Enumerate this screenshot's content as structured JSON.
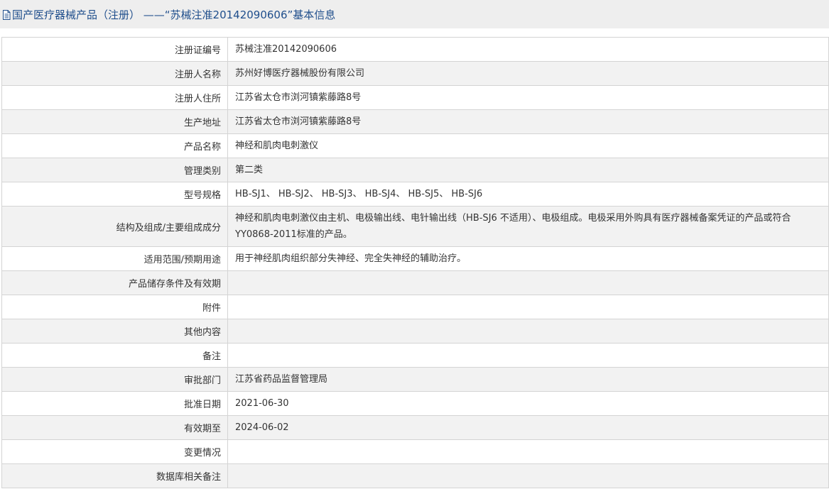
{
  "header": {
    "title": "国产医疗器械产品（注册） ——“苏械注准20142090606”基本信息",
    "icon": "document-icon"
  },
  "rows": [
    {
      "label": "注册证编号",
      "value": "苏械注准20142090606"
    },
    {
      "label": "注册人名称",
      "value": "苏州好博医疗器械股份有限公司"
    },
    {
      "label": "注册人住所",
      "value": "江苏省太仓市浏河镇紫藤路8号"
    },
    {
      "label": "生产地址",
      "value": "江苏省太仓市浏河镇紫藤路8号"
    },
    {
      "label": "产品名称",
      "value": "神经和肌肉电刺激仪"
    },
    {
      "label": "管理类别",
      "value": "第二类"
    },
    {
      "label": "型号规格",
      "value": "HB-SJ1、 HB-SJ2、 HB-SJ3、 HB-SJ4、 HB-SJ5、 HB-SJ6"
    },
    {
      "label": "结构及组成/主要组成成分",
      "value": "神经和肌肉电刺激仪由主机、电极输出线、电针输出线（HB-SJ6 不适用）、电极组成。电极采用外购具有医疗器械备案凭证的产品或符合YY0868-2011标准的产品。"
    },
    {
      "label": "适用范围/预期用途",
      "value": "用于神经肌肉组织部分失神经、完全失神经的辅助治疗。"
    },
    {
      "label": "产品储存条件及有效期",
      "value": ""
    },
    {
      "label": "附件",
      "value": ""
    },
    {
      "label": "其他内容",
      "value": ""
    },
    {
      "label": "备注",
      "value": ""
    },
    {
      "label": "审批部门",
      "value": "江苏省药品监督管理局"
    },
    {
      "label": "批准日期",
      "value": "2021-06-30"
    },
    {
      "label": "有效期至",
      "value": "2024-06-02"
    },
    {
      "label": "变更情况",
      "value": ""
    },
    {
      "label": "数据库相关备注",
      "value": ""
    }
  ],
  "colors": {
    "title": "#1f4e8c",
    "header_bg": "#eeeeee",
    "border": "#d4d4d4",
    "row_alt": "#f2f2f2"
  }
}
